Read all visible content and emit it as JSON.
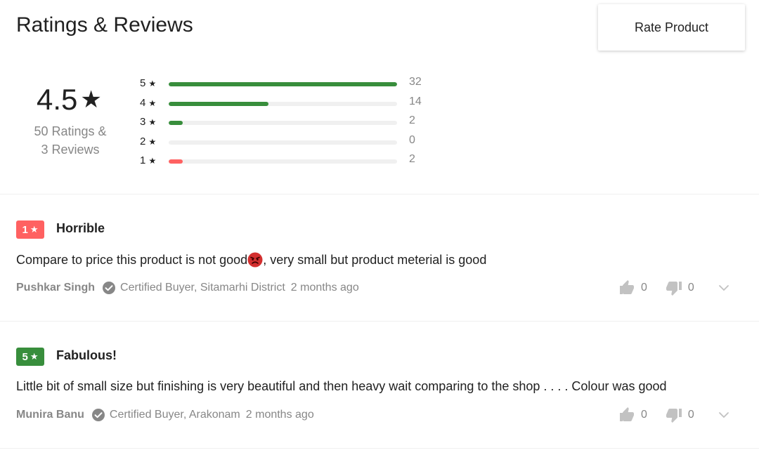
{
  "header": {
    "title": "Ratings & Reviews",
    "rate_button": "Rate Product"
  },
  "summary": {
    "average": "4.5",
    "star_glyph": "★",
    "ratings_line": "50 Ratings &",
    "reviews_line": "3 Reviews",
    "distribution": [
      {
        "stars": "5",
        "count": "32",
        "fraction": 1.0,
        "color": "#388e3c"
      },
      {
        "stars": "4",
        "count": "14",
        "fraction": 0.4375,
        "color": "#388e3c"
      },
      {
        "stars": "3",
        "count": "2",
        "fraction": 0.0625,
        "color": "#388e3c"
      },
      {
        "stars": "2",
        "count": "0",
        "fraction": 0.0,
        "color": "#388e3c"
      },
      {
        "stars": "1",
        "count": "2",
        "fraction": 0.0625,
        "color": "#ff6161"
      }
    ]
  },
  "reviews": [
    {
      "rating": "1",
      "badge_color": "#ff6161",
      "title": "Horrible",
      "body_before": "Compare to price this product is not good",
      "emoji": "angry-face-icon",
      "body_after": ", very small but product meterial is good",
      "author": "Pushkar Singh",
      "certified": "Certified Buyer, Sitamarhi District",
      "time": "2 months ago",
      "likes": "0",
      "dislikes": "0"
    },
    {
      "rating": "5",
      "badge_color": "#388e3c",
      "title": "Fabulous!",
      "body_before": "Little bit of small size but finishing is very beautiful and then heavy wait comparing to the shop . . . . Colour was good",
      "emoji": "",
      "body_after": "",
      "author": "Munira Banu",
      "certified": "Certified Buyer, Arakonam",
      "time": "2 months ago",
      "likes": "0",
      "dislikes": "0"
    }
  ]
}
